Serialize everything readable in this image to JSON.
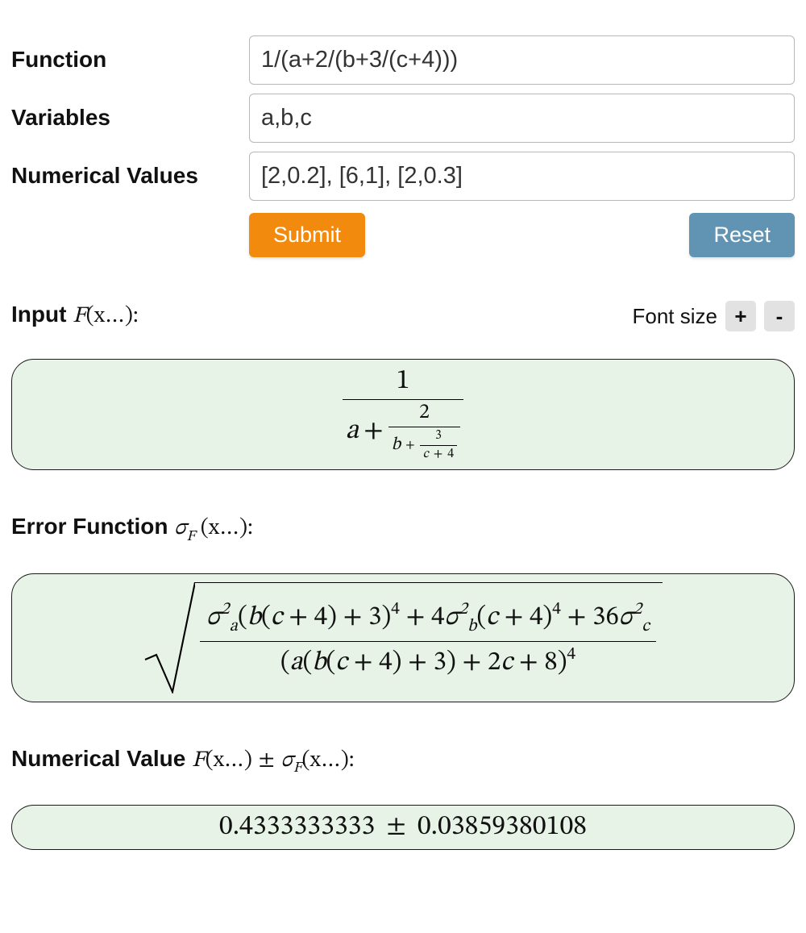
{
  "form": {
    "function_label": "Function",
    "function_value": "1/(a+2/(b+3/(c+4)))",
    "variables_label": "Variables",
    "variables_value": "a,b,c",
    "numvals_label": "Numerical Values",
    "numvals_value": "[2,0.2], [6,1], [2,0.3]",
    "submit_label": "Submit",
    "reset_label": "Reset"
  },
  "fontsize": {
    "label": "Font size",
    "plus": "+",
    "minus": "-"
  },
  "headings": {
    "input_prefix": "Input",
    "input_math_F": "F",
    "input_math_args": "(x…):",
    "error_prefix": "Error Function",
    "error_math_sigma": "σ",
    "error_math_Fsub": "F",
    "error_math_args": "(x…):",
    "numeric_prefix": "Numerical Value",
    "numeric_math_F": "F",
    "numeric_math_args1": "(x…)",
    "numeric_pm": "±",
    "numeric_math_sigma": "σ",
    "numeric_math_Fsub": "F",
    "numeric_math_args2": "(x…):"
  },
  "formula_cf": {
    "num0": "1",
    "a": "a",
    "plus": "+",
    "num1": "2",
    "b": "b",
    "num2": "3",
    "c": "c",
    "num3": "4"
  },
  "formula_err": {
    "sigma": "σ",
    "a": "a",
    "b": "b",
    "c": "c",
    "t1_pre": "(",
    "t1_b": "b",
    "t1_paren_l": "(",
    "t1_c": "c",
    "t1_plus4": " + 4",
    "t1_paren_r": ")",
    "t1_plus3": " + 3",
    "t1_post": ")",
    "pow4": "4",
    "plus_spaced": " + ",
    "four": "4",
    "t2_paren_l": "(",
    "t2_c": "c",
    "t2_plus4": " + 4",
    "t2_paren_r": ")",
    "thirtysix": "36",
    "den_l": "(",
    "den_a": "a",
    "den_paren_l": "(",
    "den_b": "b",
    "den_c_l": "(",
    "den_c": "c",
    "den_c_plus4": " + 4",
    "den_c_r": ")",
    "den_plus3": " + 3",
    "den_paren_r": ")",
    "den_plus2c": " + 2",
    "den_c2": "c",
    "den_plus8": " + 8",
    "den_r": ")",
    "two": "2"
  },
  "numeric_value": {
    "F": "0.4333333333",
    "pm": "±",
    "sigma": "0.03859380108"
  }
}
